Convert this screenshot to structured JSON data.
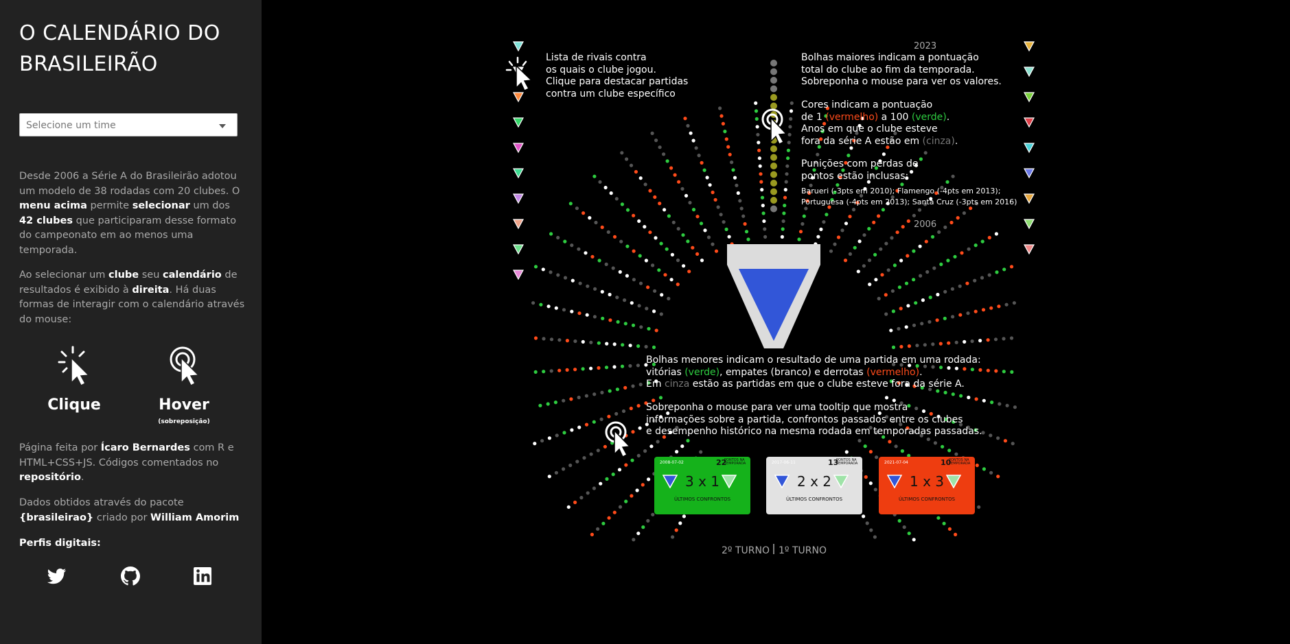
{
  "sidebar": {
    "title": "O CALENDÁRIO DO BRASILEIRÃO",
    "select_placeholder": "Selecione um time",
    "intro": [
      {
        "t": "Desde 2006 a Série A do Brasileirão adotou um modelo de 38 rodadas com 20 clubes. O ",
        "b": false
      },
      {
        "t": "menu acima",
        "b": true
      },
      {
        "t": " permite ",
        "b": false
      },
      {
        "t": "selecionar",
        "b": true
      },
      {
        "t": " um dos ",
        "b": false
      },
      {
        "t": "42 clubes",
        "b": true
      },
      {
        "t": " que participaram desse formato do campeonato em ao menos uma temporada.",
        "b": false
      }
    ],
    "usage": [
      {
        "t": "Ao selecionar um ",
        "b": false
      },
      {
        "t": "clube",
        "b": true
      },
      {
        "t": " seu ",
        "b": false
      },
      {
        "t": "calendário",
        "b": true
      },
      {
        "t": " de resultados é exibido à ",
        "b": false
      },
      {
        "t": "direita",
        "b": true
      },
      {
        "t": ". Há duas formas de interagir com o calendário através do mouse:",
        "b": false
      }
    ],
    "click_label": "Clique",
    "hover_label": "Hover",
    "hover_sub": "(sobreposição)",
    "credits": [
      {
        "t": "Página feita por ",
        "b": false
      },
      {
        "t": "Ícaro Bernardes",
        "b": true
      },
      {
        "t": " com R e HTML+CSS+JS. Códigos comentados no ",
        "b": false
      },
      {
        "t": "repositório",
        "b": true
      },
      {
        "t": ".",
        "b": false
      }
    ],
    "data_source": [
      {
        "t": "Dados obtidos através do pacote ",
        "b": false
      },
      {
        "t": "{brasileirao}",
        "b": true
      },
      {
        "t": " criado por ",
        "b": false
      },
      {
        "t": "William Amorim",
        "b": true
      }
    ],
    "profiles_label": "Perfis digitais:",
    "socials": [
      "twitter-icon",
      "github-icon",
      "linkedin-icon"
    ]
  },
  "viz": {
    "year_top": "2023",
    "year_bottom": "2006",
    "rivals_text": [
      "Lista de rivais contra",
      "os quais o clube jogou.",
      "Clique para destacar partidas",
      "contra um clube específico"
    ],
    "bubbles_big": [
      "Bolhas maiores indicam a pontuação",
      "total do clube ao fim da temporada.",
      "Sobreponha o mouse para ver os valores."
    ],
    "colors_text": {
      "l1a": "Cores indicam a pontuação",
      "l2a": "de 1 ",
      "l2b": "(vermelho)",
      "l2c": " a 100 ",
      "l2d": "(verde)",
      "l2e": ".",
      "l3": "Anos em que o clube esteve",
      "l4a": "fora da série A estão em ",
      "l4b": "(cinza)",
      "l4c": "."
    },
    "punish_title": [
      "Punições com perdas de",
      "pontos estão inclusas:"
    ],
    "punish_list": [
      "Barueri (-3pts em 2010); Flamengo (-4pts em 2013);",
      "Portuguesa (-4pts em 2013); Santa Cruz (-3pts em 2016)"
    ],
    "small_bubbles": {
      "l1": "Bolhas menores indicam o resultado de uma partida em uma rodada:",
      "l2a": "vitórias ",
      "l2b": "(verde)",
      "l2c": ", empates (branco) e derrotas ",
      "l2d": "(vermelho)",
      "l2e": ".",
      "l3a": "Em ",
      "l3b": "cinza",
      "l3c": " estão as partidas em que o clube esteve fora da série A."
    },
    "tooltip_text": [
      "Sobreponha o mouse para ver uma tooltip que mostra",
      "informações sobre a partida, confrontos passados entre os clubes",
      "e desempenho histórico na mesma rodada em temporadas passadas."
    ],
    "cards": [
      {
        "date": "2008-07-02",
        "round": "22",
        "pts_label": "PONTOS NA TEMPORADA",
        "score": "3 x 1",
        "hist": "ÚLTIMOS CONFRONTOS",
        "bg": "#15b21b",
        "fg": "#111"
      },
      {
        "date": "2017-06-11",
        "round": "13",
        "pts_label": "PONTOS NA TEMPORADA",
        "score": "2 x 2",
        "hist": "ÚLTIMOS CONFRONTOS",
        "bg": "#e2e2e2",
        "fg": "#111"
      },
      {
        "date": "2021-07-04",
        "round": "10",
        "pts_label": "PONTOS NA TEMPORADA",
        "score": "1 x 3",
        "hist": "ÚLTIMOS CONFRONTOS",
        "bg": "#ee3d10",
        "fg": "#111"
      }
    ],
    "turno_left": "2º TURNO",
    "turno_right": "1º TURNO",
    "rival_colors_left": [
      "#7fe3d9",
      "#ffffff",
      "#ff8a3d",
      "#35d96a",
      "#e254c9",
      "#3ddc92",
      "#c58ae8",
      "#f0a48a",
      "#6ee08c",
      "#e888d8"
    ],
    "rival_colors_right": [
      "#e8b33d",
      "#8ee3d2",
      "#7ad13b",
      "#e0404a",
      "#4ad3d9",
      "#6c7ae8",
      "#e8a840",
      "#8fde72",
      "#f08a8a"
    ],
    "colors": {
      "accent_blue": "#3256d8",
      "win": "#2ecc40",
      "loss": "#ff4b1a",
      "draw": "#ffffff",
      "absent": "#555555"
    }
  }
}
